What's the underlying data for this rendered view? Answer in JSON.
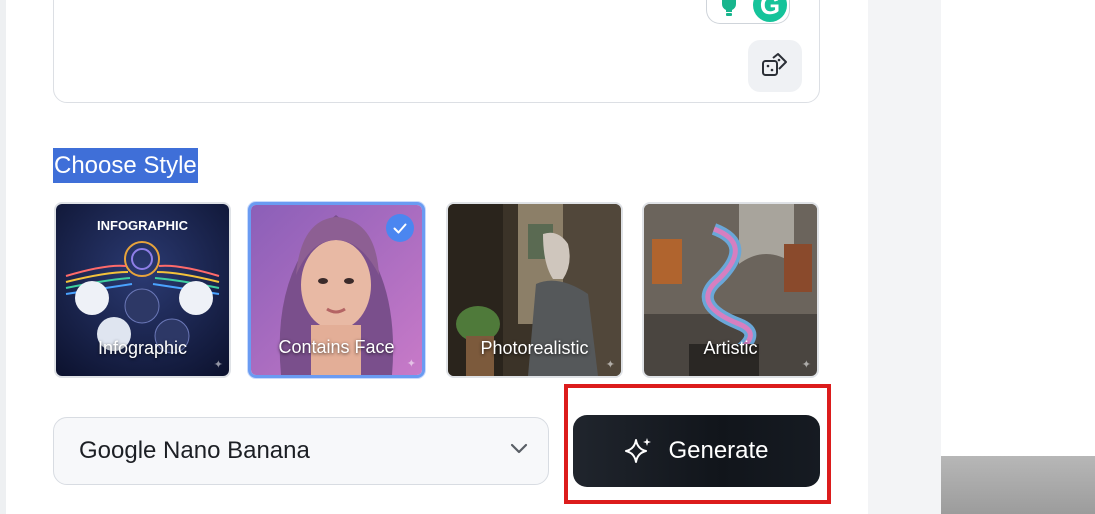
{
  "editor": {
    "random_icon": "dice-shuffle-icon",
    "extension_icons": [
      "lightbulb-icon",
      "grammarly-icon"
    ],
    "grammarly_letter": "G"
  },
  "style_section": {
    "title": "Choose Style",
    "options": [
      {
        "label": "Infographic",
        "selected": false,
        "card_heading": "INFOGRAPHIC"
      },
      {
        "label": "Contains Face",
        "selected": true
      },
      {
        "label": "Photorealistic",
        "selected": false
      },
      {
        "label": "Artistic",
        "selected": false
      }
    ]
  },
  "model_select": {
    "value": "Google Nano Banana",
    "icon": "chevron-down-icon"
  },
  "generate": {
    "label": "Generate",
    "icon": "sparkle-icon"
  },
  "colors": {
    "selection_highlight": "#3f6fd8",
    "selected_border": "#6a9bf2",
    "check_badge": "#4b86f0",
    "generate_bg": "#161b22",
    "annotation_box": "#dc1c1c"
  }
}
